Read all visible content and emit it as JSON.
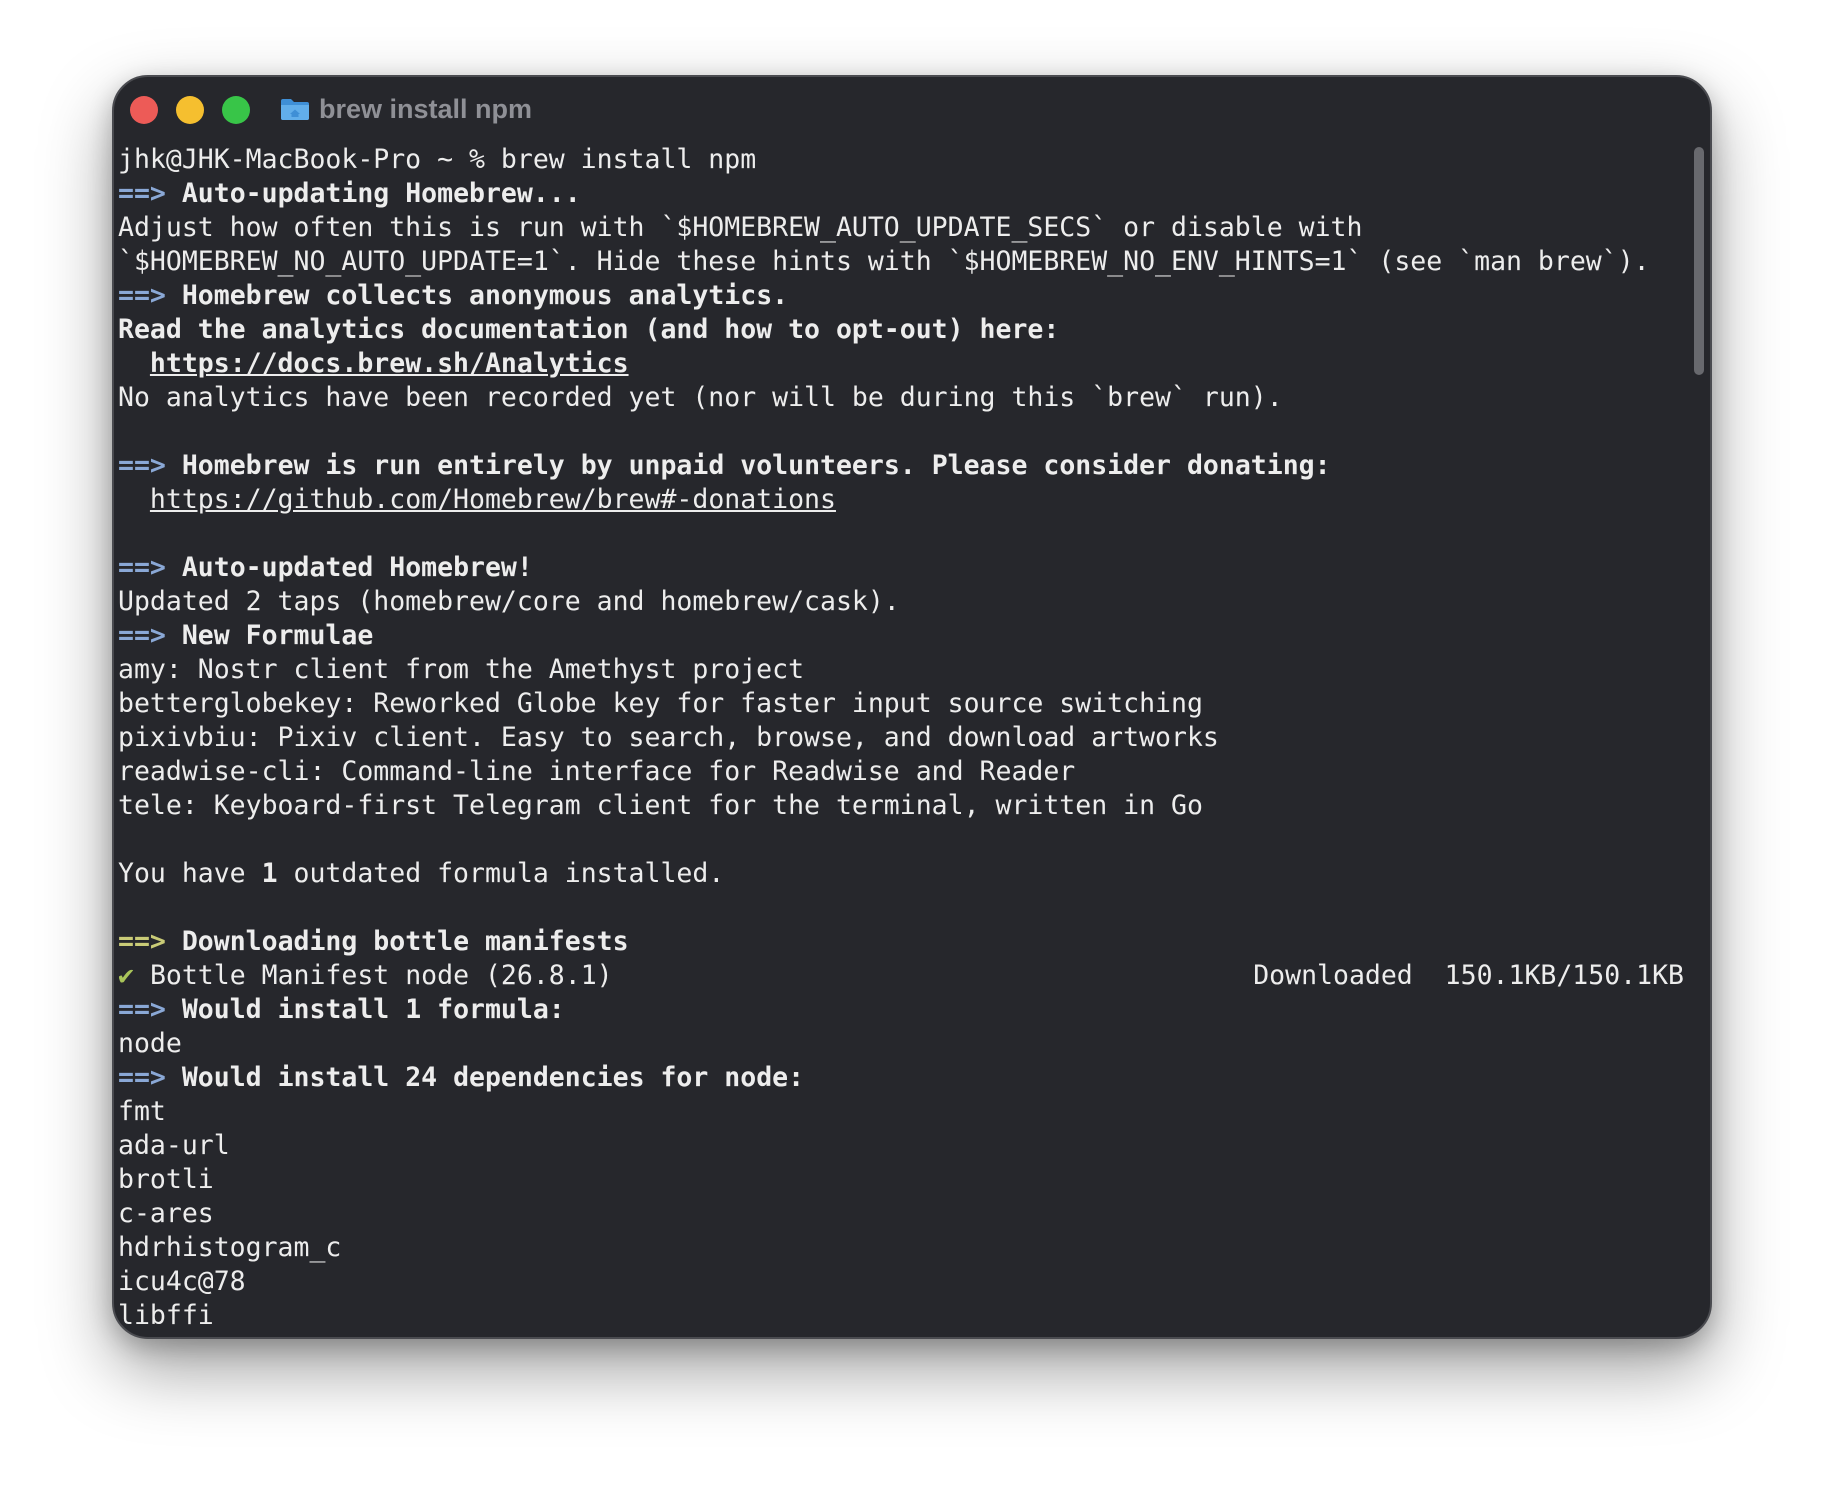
{
  "window": {
    "title": "brew install npm",
    "folder_icon": "folder-icon"
  },
  "terminal": {
    "prompt": "jhk@JHK-MacBook-Pro ~ % brew install npm",
    "arrow": "==>",
    "check": "✔",
    "auto_updating": "Auto-updating Homebrew...",
    "adjust_1": "Adjust how often this is run with `$HOMEBREW_AUTO_UPDATE_SECS` or disable with",
    "adjust_2": "`$HOMEBREW_NO_AUTO_UPDATE=1`. Hide these hints with `$HOMEBREW_NO_ENV_HINTS=1` (see `man brew`).",
    "analytics_heading": "Homebrew collects anonymous analytics.",
    "analytics_read": "Read the analytics documentation (and how to opt-out) here:",
    "analytics_url": "https://docs.brew.sh/Analytics",
    "analytics_none": "No analytics have been recorded yet (nor will be during this `brew` run).",
    "volunteers": "Homebrew is run entirely by unpaid volunteers. Please consider donating:",
    "donations_url": "https://github.com/Homebrew/brew#-donations",
    "auto_updated": "Auto-updated Homebrew!",
    "updated_taps": "Updated 2 taps (homebrew/core and homebrew/cask).",
    "new_formulae": "New Formulae",
    "formulae": [
      "amy: Nostr client from the Amethyst project",
      "betterglobekey: Reworked Globe key for faster input source switching",
      "pixivbiu: Pixiv client. Easy to search, browse, and download artworks",
      "readwise-cli: Command-line interface for Readwise and Reader",
      "tele: Keyboard-first Telegram client for the terminal, written in Go"
    ],
    "outdated_pre": "You have ",
    "outdated_count": "1",
    "outdated_post": " outdated formula installed.",
    "downloading": "Downloading bottle manifests",
    "manifest": "Bottle Manifest node (26.8.1)",
    "manifest_status": "Downloaded  150.1KB/150.1KB",
    "would_install_1": "Would install 1 formula:",
    "formula_node": "node",
    "would_install_24": "Would install 24 dependencies for node:",
    "dependencies": [
      "fmt",
      "ada-url",
      "brotli",
      "c-ares",
      "hdrhistogram_c",
      "icu4c@78",
      "libffi"
    ]
  },
  "colors": {
    "window_bg": "#26272c",
    "text": "#ededed",
    "arrow_blue": "#8aa8d6",
    "arrow_yellow": "#c9cb77",
    "check": "#a9c45a",
    "close": "#ed5b57",
    "minimize": "#f5bf2f",
    "zoom": "#38c548"
  }
}
